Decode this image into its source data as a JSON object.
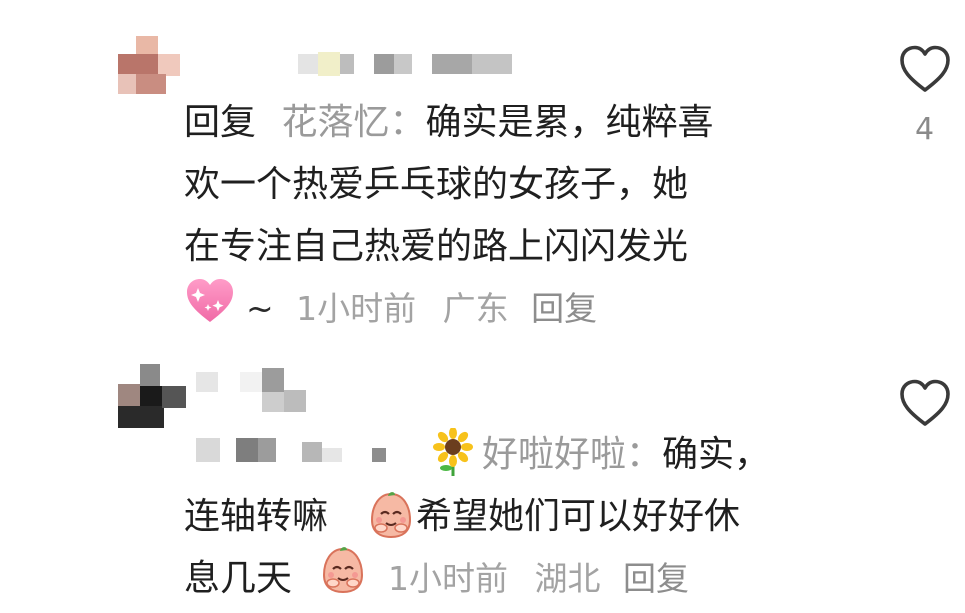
{
  "comment1": {
    "reply_prefix": "回复",
    "reply_target": "花落忆：",
    "line1_rest": "确实是累，纯粹喜",
    "line2": "欢一个热爱乒乓球的女孩子，她",
    "line3": "在专注自己热爱的路上闪闪发光",
    "meta_tilde": "~",
    "time": "1小时前",
    "location": "广东",
    "reply_label": "回复",
    "like_count": "4"
  },
  "comment2": {
    "reply_target": "好啦好啦：",
    "line1_rest": "确实，",
    "line2_a": "连轴转嘛",
    "line2_b": "希望她们可以好好休",
    "line3": "息几天",
    "time": "1小时前",
    "location": "湖北",
    "reply_label": "回复"
  },
  "icons": {
    "like": "heart-outline-icon",
    "sparkle_heart": "sparkling-heart-emoji",
    "sunflower": "sunflower-emoji",
    "pleading_face": "pleading-face-sticker"
  },
  "colors": {
    "text": "#1f1f1f",
    "muted": "#9a9a9a",
    "heart_pink": "#f47fb0"
  }
}
